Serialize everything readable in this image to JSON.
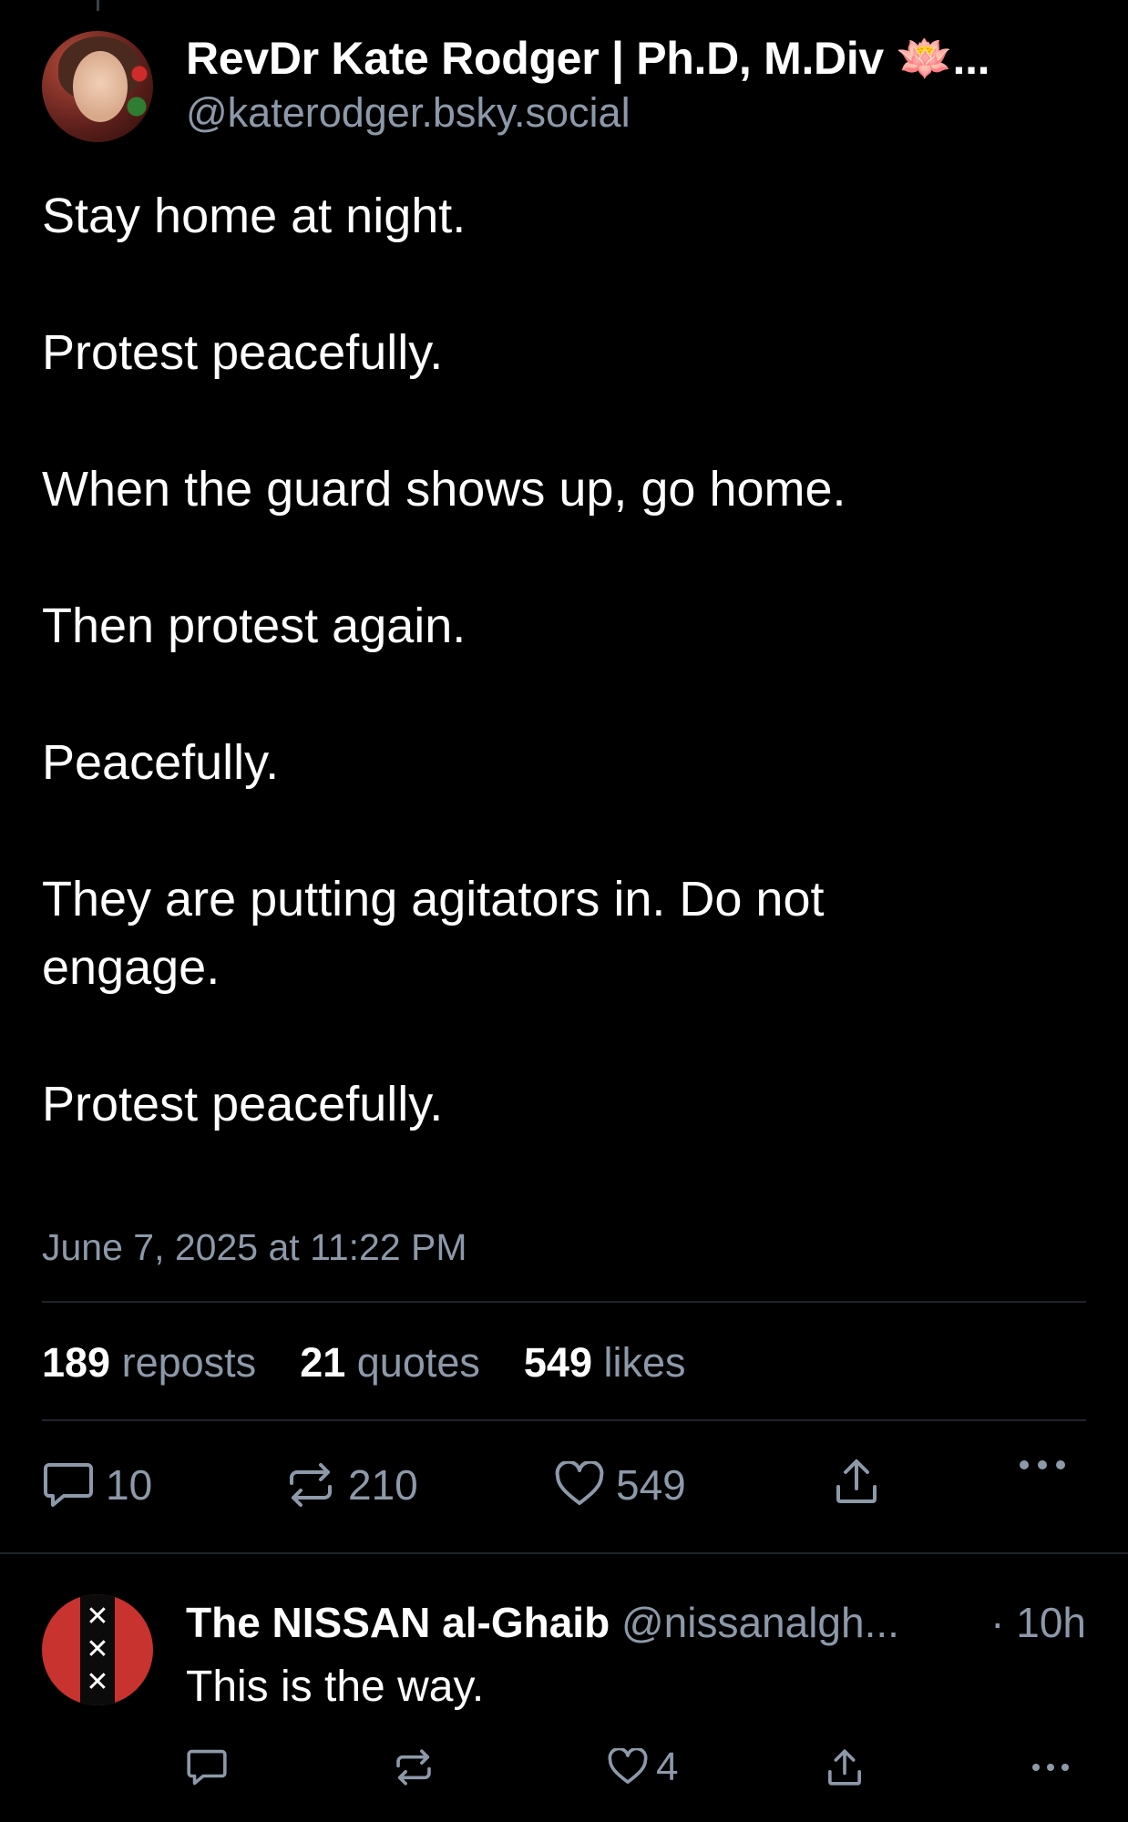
{
  "post": {
    "author": {
      "display_name": "RevDr Kate Rodger | Ph.D, M.Div 🪷...",
      "handle": "@katerodger.bsky.social"
    },
    "paragraphs": [
      "Stay home at night.",
      "Protest peacefully.",
      "When the guard shows up, go home.",
      "Then protest again.",
      "Peacefully.",
      "They are putting agitators in. Do not engage.",
      "Protest peacefully."
    ],
    "timestamp": "June 7, 2025 at 11:22 PM",
    "stats": {
      "reposts_count": "189",
      "reposts_label": "reposts",
      "quotes_count": "21",
      "quotes_label": "quotes",
      "likes_count": "549",
      "likes_label": "likes"
    },
    "actions": {
      "reply_count": "10",
      "repost_count": "210",
      "like_count": "549"
    }
  },
  "reply": {
    "display_name": "The NISSAN al-Ghaib",
    "handle": "@nissanalgh...",
    "time": "· 10h",
    "text": "This is the way.",
    "like_count": "4",
    "avatar_marks": [
      "✕",
      "✕",
      "✕"
    ]
  },
  "icons": {
    "reply": "speech-bubble-icon",
    "repost": "repost-arrows-icon",
    "like": "heart-icon",
    "share": "share-upload-icon",
    "more": "more-horizontal-icon"
  },
  "colors": {
    "background": "#000000",
    "text": "#ffffff",
    "muted": "#8d99a8",
    "divider": "#1f242b"
  }
}
